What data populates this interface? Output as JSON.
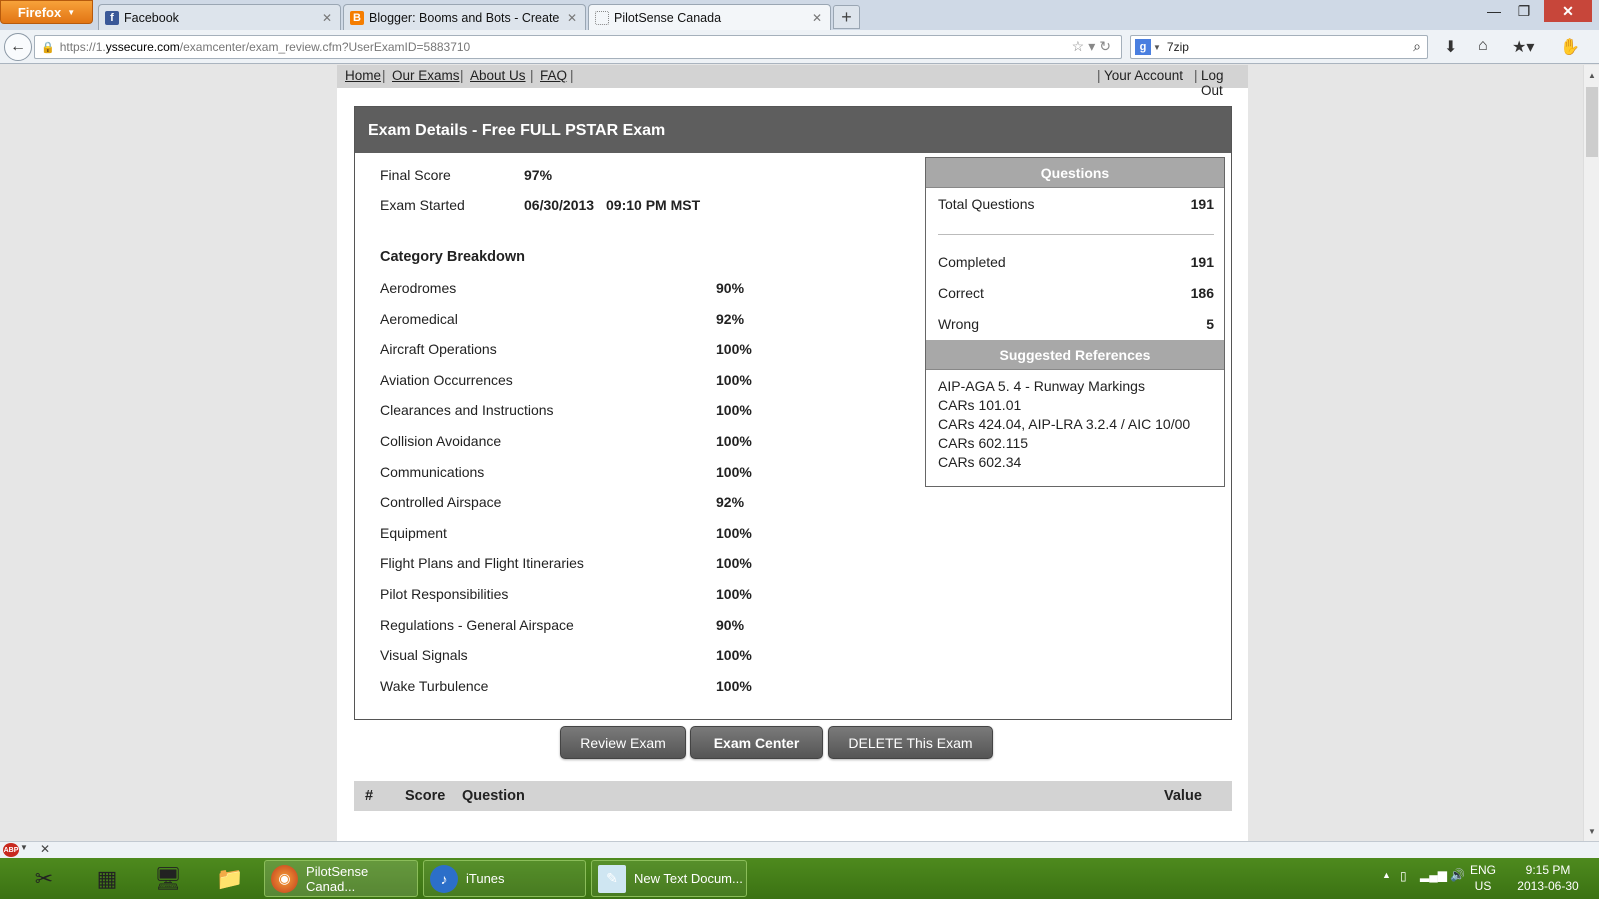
{
  "browser": {
    "app_button": "Firefox",
    "tabs": [
      {
        "title": "Facebook",
        "icon": "facebook-icon"
      },
      {
        "title": "Blogger: Booms and Bots - Create post",
        "icon": "blogger-icon"
      },
      {
        "title": "PilotSense Canada",
        "icon": "blank-page-icon"
      }
    ],
    "url_prefix": "https://1.",
    "url_host": "yssecure.com",
    "url_path": "/examcenter/exam_review.cfm?UserExamID=5883710",
    "search_value": "7zip"
  },
  "site_nav": {
    "left": [
      "Home",
      "Our Exams",
      "About Us",
      "FAQ"
    ],
    "right": [
      "Your Account",
      "Log Out"
    ]
  },
  "exam": {
    "header": "Exam Details - Free FULL PSTAR Exam",
    "final_score_label": "Final Score",
    "final_score": "97%",
    "started_label": "Exam Started",
    "started_date": "06/30/2013",
    "started_time": "09:10 PM MST",
    "category_title": "Category Breakdown",
    "categories": [
      {
        "name": "Aerodromes",
        "score": "90%"
      },
      {
        "name": "Aeromedical",
        "score": "92%"
      },
      {
        "name": "Aircraft Operations",
        "score": "100%"
      },
      {
        "name": "Aviation Occurrences",
        "score": "100%"
      },
      {
        "name": "Clearances and Instructions",
        "score": "100%"
      },
      {
        "name": "Collision Avoidance",
        "score": "100%"
      },
      {
        "name": "Communications",
        "score": "100%"
      },
      {
        "name": "Controlled Airspace",
        "score": "92%"
      },
      {
        "name": "Equipment",
        "score": "100%"
      },
      {
        "name": "Flight Plans and Flight Itineraries",
        "score": "100%"
      },
      {
        "name": "Pilot Responsibilities",
        "score": "100%"
      },
      {
        "name": "Regulations - General Airspace",
        "score": "90%"
      },
      {
        "name": "Visual Signals",
        "score": "100%"
      },
      {
        "name": "Wake Turbulence",
        "score": "100%"
      }
    ]
  },
  "questions_box": {
    "title": "Questions",
    "total_label": "Total Questions",
    "total": "191",
    "completed_label": "Completed",
    "completed": "191",
    "correct_label": "Correct",
    "correct": "186",
    "wrong_label": "Wrong",
    "wrong": "5"
  },
  "references": {
    "title": "Suggested References",
    "items": [
      "AIP-AGA 5. 4 - Runway Markings",
      "CARs 101.01",
      "CARs 424.04, AIP-LRA 3.2.4 / AIC 10/00",
      "CARs 602.115",
      "CARs 602.34"
    ]
  },
  "buttons": {
    "review": "Review Exam",
    "center": "Exam Center",
    "delete": "DELETE This Exam"
  },
  "question_table": {
    "headers": [
      "#",
      "Score",
      "Question",
      "Value"
    ]
  },
  "taskbar": {
    "tasks": [
      "PilotSense Canad...",
      "iTunes",
      "New Text Docum..."
    ],
    "lang_top": "ENG",
    "lang_bottom": "US",
    "time": "9:15 PM",
    "date": "2013-06-30"
  }
}
